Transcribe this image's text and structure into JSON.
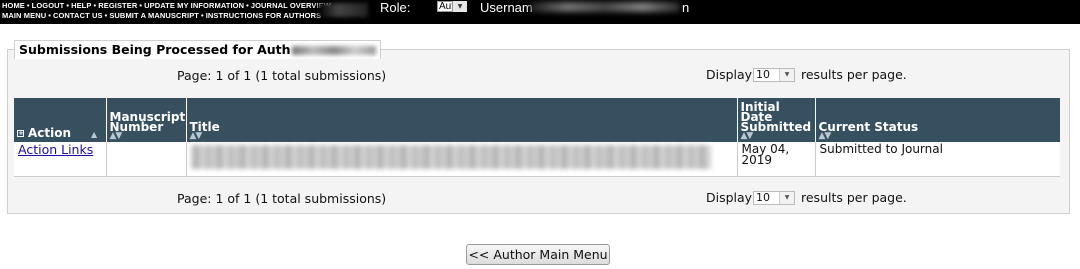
{
  "nav": {
    "row1": [
      "HOME",
      "LOGOUT",
      "HELP",
      "REGISTER",
      "UPDATE MY INFORMATION",
      "JOURNAL OVERVIEW"
    ],
    "row2": [
      "MAIN MENU",
      "CONTACT US",
      "SUBMIT A MANUSCRIPT",
      "INSTRUCTIONS FOR AUTHORS"
    ],
    "separator": "•"
  },
  "header": {
    "role_label": "Role:",
    "role_value": "Author",
    "username_label": "Usernam",
    "username_tail": "n"
  },
  "panel": {
    "legend": "Submissions Being Processed for Auth"
  },
  "pager_top": {
    "page_text": "Page: 1 of 1 (1 total submissions)",
    "display_label": "Display",
    "per_page_value": "10",
    "per_page_suffix": "results per page."
  },
  "pager_bottom": {
    "page_text": "Page: 1 of 1 (1 total submissions)",
    "display_label": "Display",
    "per_page_value": "10",
    "per_page_suffix": "results per page."
  },
  "table": {
    "columns": {
      "action": "Action",
      "manuscript_number": "Manuscript Number",
      "title": "Title",
      "initial_date": "Initial Date Submitted",
      "current_status": "Current Status"
    },
    "sort_arrows": "▲▼",
    "rows": [
      {
        "action": "Action Links",
        "manuscript_number": "",
        "date": "May 04, 2019",
        "status": "Submitted to Journal"
      }
    ]
  },
  "footer": {
    "main_menu_button": "<< Author Main Menu"
  },
  "colors": {
    "topbar": "#000000",
    "table_header": "#37505f",
    "link": "#1a0dab"
  },
  "icons": {
    "select_arrow": "chevron-down-icon",
    "sort": "sort-arrows-icon",
    "expand": "expand-icon"
  }
}
